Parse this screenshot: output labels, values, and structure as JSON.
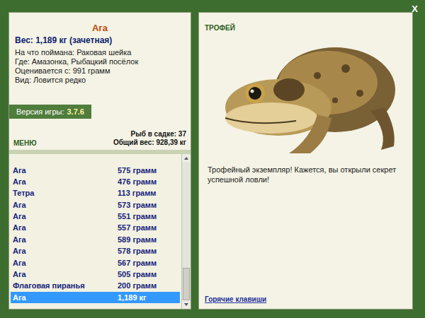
{
  "window": {
    "close": "X"
  },
  "fish": {
    "name": "Ага",
    "weight": "Вес: 1,189 кг (зачетная)",
    "details": [
      "На что поймана: Раковая шейка",
      "Где: Амазонка, Рыбацкий посёлок",
      "Оценивается с: 991 грамм",
      "Вид: Ловится редко"
    ]
  },
  "version": {
    "label": "Версия игры:",
    "value": "3.7.6"
  },
  "menu": "МЕНЮ",
  "keepnet": {
    "count": "Рыб в садке: 37",
    "total": "Общий вес: 928,39 кг"
  },
  "catches": [
    {
      "name": "Ага",
      "weight": "575 грамм",
      "selected": false
    },
    {
      "name": "Ага",
      "weight": "476 грамм",
      "selected": false
    },
    {
      "name": "Тетра",
      "weight": "113 грамм",
      "selected": false
    },
    {
      "name": "Ага",
      "weight": "573 грамм",
      "selected": false
    },
    {
      "name": "Ага",
      "weight": "551 грамм",
      "selected": false
    },
    {
      "name": "Ага",
      "weight": "557 грамм",
      "selected": false
    },
    {
      "name": "Ага",
      "weight": "589 грамм",
      "selected": false
    },
    {
      "name": "Ага",
      "weight": "578 грамм",
      "selected": false
    },
    {
      "name": "Ага",
      "weight": "567 грамм",
      "selected": false
    },
    {
      "name": "Ага",
      "weight": "505 грамм",
      "selected": false
    },
    {
      "name": "Флаговая пиранья",
      "weight": "200 грамм",
      "selected": false
    },
    {
      "name": "Ага",
      "weight": "1,189 кг",
      "selected": true
    }
  ],
  "scrollbar": {
    "level": 1
  },
  "trophy": {
    "label": "ТРОФЕЙ",
    "message": "Трофейный экземпляр! Кажется, вы открыли секрет успешной ловли!"
  },
  "hotkeys": "Горячие клавиши"
}
